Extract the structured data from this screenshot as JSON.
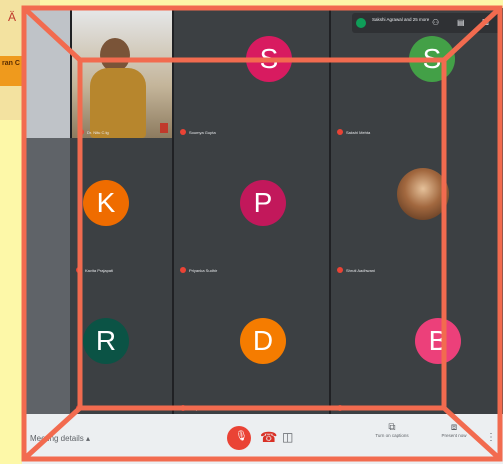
{
  "colors": {
    "slide_bg": "#fdf8a8",
    "meet_bg": "#202124",
    "tile_bg": "#3c4043",
    "bottom_bar": "#eceff1",
    "highlight": "#f26b4f",
    "mic_off": "#ea4335"
  },
  "slide": {
    "tag_text": "ran C"
  },
  "top_info": {
    "people_text": "Sakshi Agrawal and 25 more"
  },
  "tiles": [
    {
      "name": "Dr. Nitu C.tg",
      "avatar_letter": "",
      "color": "#5f6368",
      "type": "video"
    },
    {
      "name": "Soumya Gupta",
      "avatar_letter": "S",
      "color": "#d81b60"
    },
    {
      "name": "Sakshi Mehta",
      "avatar_letter": "S",
      "color": "#43a047"
    },
    {
      "name": "Kavita Prajapati",
      "avatar_letter": "K",
      "color": "#ef6c00"
    },
    {
      "name": "Priyanka Sudhir",
      "avatar_letter": "P",
      "color": "#c2185b"
    },
    {
      "name": "Shruti Aadhwani",
      "avatar_letter": "",
      "color": "#5f6368",
      "type": "photo"
    },
    {
      "name": "Roshani Malhotra",
      "avatar_letter": "R",
      "color": "#0b5345"
    },
    {
      "name": "Deepika saxena",
      "avatar_letter": "D",
      "color": "#f57c00"
    },
    {
      "name": "Bhumika Vadhar",
      "avatar_letter": "B",
      "color": "#ec407a"
    }
  ],
  "bottom_bar": {
    "meeting_details": "Meeting details",
    "captions_label": "Turn on captions",
    "present_label": "Present now"
  }
}
